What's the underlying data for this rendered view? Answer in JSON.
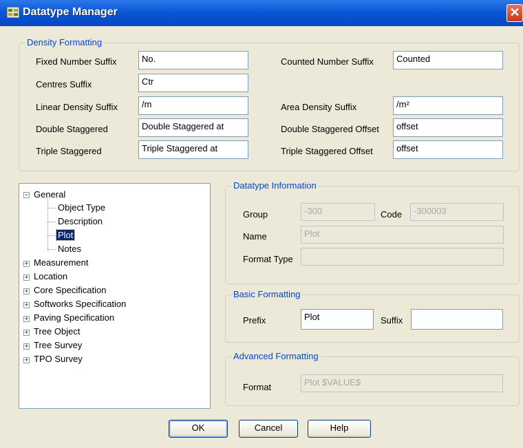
{
  "window": {
    "title": "Datatype Manager"
  },
  "density": {
    "legend": "Density Formatting",
    "fixed_number_suffix": {
      "label": "Fixed Number Suffix",
      "value": "No."
    },
    "counted_number_suffix": {
      "label": "Counted Number Suffix",
      "value": "Counted"
    },
    "centres_suffix": {
      "label": "Centres Suffix",
      "value": "Ctr"
    },
    "linear_density_suffix": {
      "label": "Linear Density Suffix",
      "value": "/m"
    },
    "area_density_suffix": {
      "label": "Area Density Suffix",
      "value": "/m²"
    },
    "double_staggered": {
      "label": "Double Staggered",
      "value": "Double Staggered at"
    },
    "double_staggered_offset": {
      "label": "Double Staggered Offset",
      "value": "offset"
    },
    "triple_staggered": {
      "label": "Triple Staggered",
      "value": "Triple Staggered at"
    },
    "triple_staggered_offset": {
      "label": "Triple Staggered Offset",
      "value": "offset"
    }
  },
  "tree": {
    "general": "General",
    "general_children": [
      "Object Type",
      "Description",
      "Plot",
      "Notes"
    ],
    "selected": "Plot",
    "others": [
      "Measurement",
      "Location",
      "Core Specification",
      "Softworks Specification",
      "Paving Specification",
      "Tree Object",
      "Tree Survey",
      "TPO Survey"
    ]
  },
  "info": {
    "legend": "Datatype Information",
    "group_label": "Group",
    "group_value": "-300",
    "code_label": "Code",
    "code_value": "-300003",
    "name_label": "Name",
    "name_value": "Plot",
    "format_type_label": "Format Type",
    "format_type_value": ""
  },
  "basic": {
    "legend": "Basic Formatting",
    "prefix_label": "Prefix",
    "prefix_value": "Plot",
    "suffix_label": "Suffix",
    "suffix_value": ""
  },
  "advanced": {
    "legend": "Advanced Formatting",
    "format_label": "Format",
    "format_value": "Plot $VALUE$"
  },
  "buttons": {
    "ok": "OK",
    "cancel": "Cancel",
    "help": "Help"
  },
  "icons": {
    "app": "datatype-manager-icon",
    "close": "close-icon"
  },
  "colors": {
    "titlebar": "#0b57d6",
    "legend": "#0046d5",
    "selection": "#0a246a",
    "dialog": "#ece9d8"
  }
}
